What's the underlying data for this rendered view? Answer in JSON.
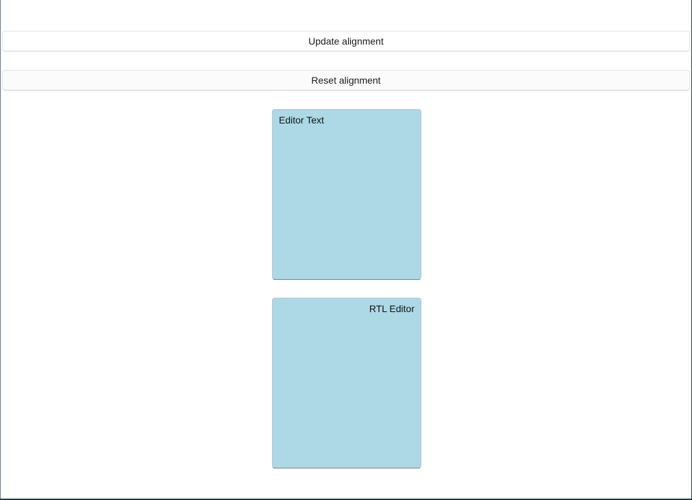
{
  "toolbar": {
    "update_label": "Update alignment",
    "reset_label": "Reset alignment"
  },
  "editors": {
    "ltr_text": "Editor Text",
    "rtl_text": "RTL Editor"
  },
  "colors": {
    "editor_background": "#add8e6",
    "window_background": "#ffffff"
  }
}
